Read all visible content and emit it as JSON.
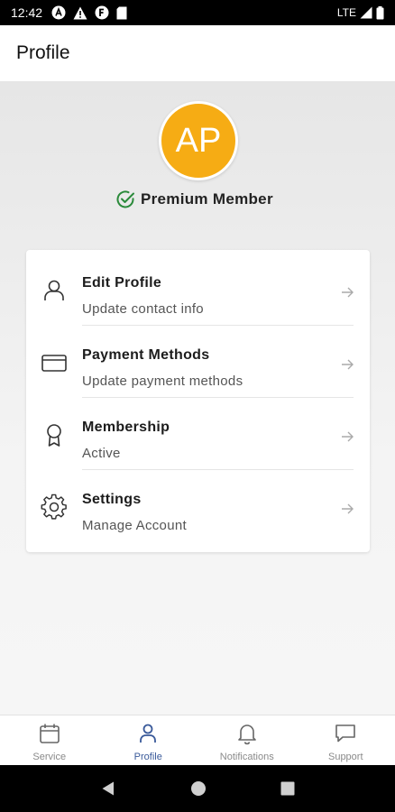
{
  "status_bar": {
    "time": "12:42",
    "network": "LTE"
  },
  "app_bar": {
    "title": "Profile"
  },
  "profile": {
    "initials": "AP",
    "avatar_color": "#f6ac14",
    "member_status": "Premium Member"
  },
  "menu": {
    "items": [
      {
        "title": "Edit Profile",
        "subtitle": "Update contact info",
        "icon": "person-icon"
      },
      {
        "title": "Payment Methods",
        "subtitle": "Update payment methods",
        "icon": "credit-card-icon"
      },
      {
        "title": "Membership",
        "subtitle": "Active",
        "icon": "award-icon"
      },
      {
        "title": "Settings",
        "subtitle": "Manage Account",
        "icon": "gear-icon"
      }
    ]
  },
  "bottom_nav": {
    "items": [
      {
        "label": "Service",
        "icon": "calendar-icon"
      },
      {
        "label": "Profile",
        "icon": "person-icon"
      },
      {
        "label": "Notifications",
        "icon": "bell-icon"
      },
      {
        "label": "Support",
        "icon": "chat-icon"
      }
    ],
    "active": "Profile",
    "active_color": "#3a5a9a"
  }
}
